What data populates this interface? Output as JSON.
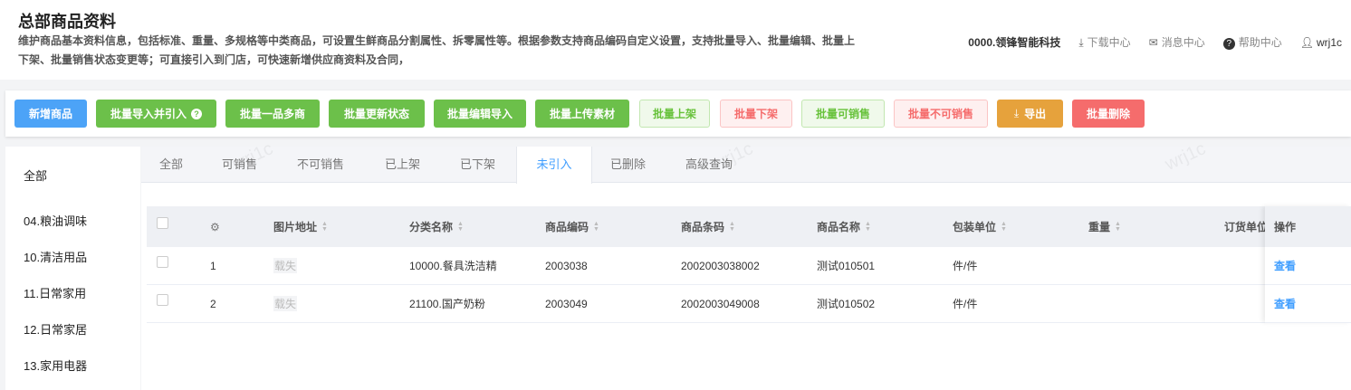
{
  "header": {
    "title": "总部商品资料",
    "description": "维护商品基本资料信息，包括标准、重量、多规格等中类商品，可设置生鲜商品分割属性、拆零属性等。根据参数支持商品编码自定义设置，支持批量导入、批量编辑、批量上下架、批量销售状态变更等；可直接引入到门店，可快速新增供应商资料及合同，",
    "org": "0000.领锋智能科技",
    "download": "下载中心",
    "messages": "消息中心",
    "help": "帮助中心",
    "user": "wrj1c"
  },
  "toolbar": {
    "add": "新增商品",
    "import_intro": "批量导入并引入",
    "multi_supplier": "批量一品多商",
    "update_status": "批量更新状态",
    "edit_import": "批量编辑导入",
    "upload_material": "批量上传素材",
    "on_shelf": "批量上架",
    "off_shelf": "批量下架",
    "sellable": "批量可销售",
    "unsellable": "批量不可销售",
    "export": "导出",
    "delete": "批量删除"
  },
  "sidebar": {
    "items": [
      "全部",
      "04.粮油调味",
      "10.清洁用品",
      "11.日常家用",
      "12.日常家居",
      "13.家用电器"
    ]
  },
  "tabs": [
    "全部",
    "可销售",
    "不可销售",
    "已上架",
    "已下架",
    "未引入",
    "已删除",
    "高级查询"
  ],
  "watermark": "wrj1c",
  "table": {
    "headers": {
      "image": "图片地址",
      "category": "分类名称",
      "code": "商品编码",
      "barcode": "商品条码",
      "name": "商品名称",
      "unit": "包装单位",
      "weight": "重量",
      "order_unit": "订货单位",
      "action": "操作"
    },
    "rows": [
      {
        "index": "1",
        "image": "载失",
        "category": "10000.餐具洗洁精",
        "code": "2003038",
        "barcode": "2002003038002",
        "name": "测试010501",
        "unit": "件/件",
        "action": "查看"
      },
      {
        "index": "2",
        "image": "载失",
        "category": "21100.国产奶粉",
        "code": "2003049",
        "barcode": "2002003049008",
        "name": "测试010502",
        "unit": "件/件",
        "action": "查看"
      }
    ]
  }
}
